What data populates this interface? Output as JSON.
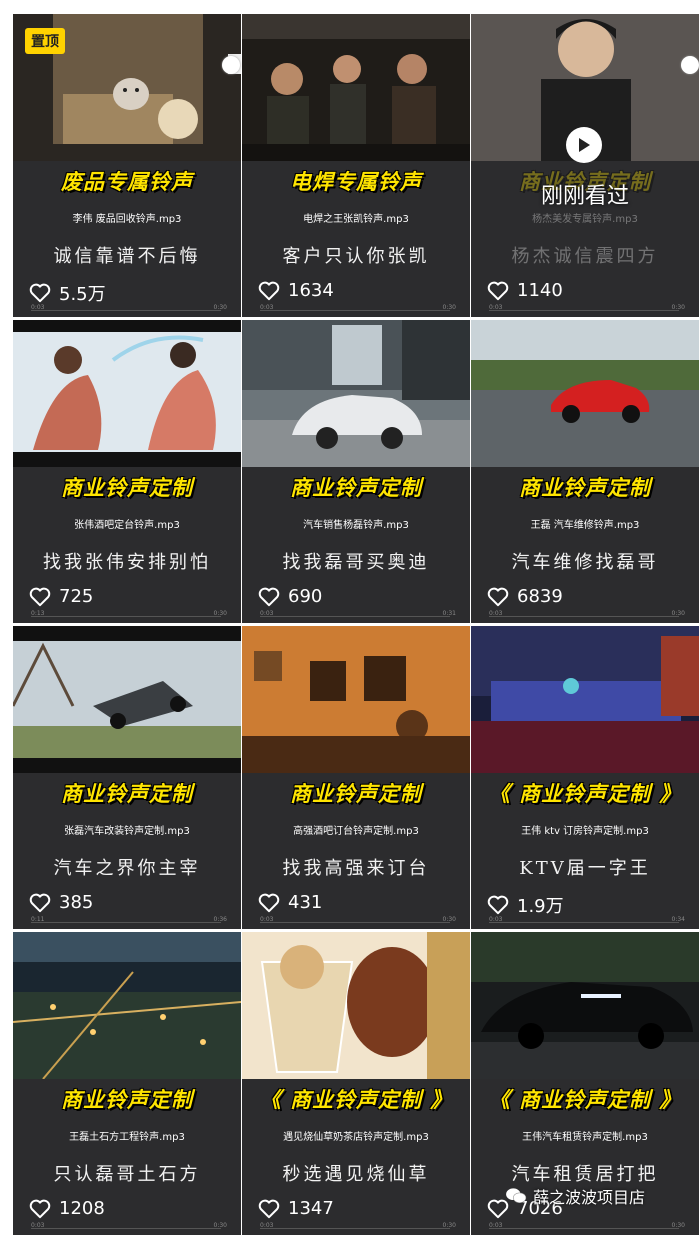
{
  "pinned_badge": "置顶",
  "recently_watched": "刚刚看过",
  "watermark": "薛之波波项目店",
  "cards": [
    {
      "title": "废品专属铃声",
      "filename": "李伟 废品回收铃声.mp3",
      "caption": "诚信靠谱不后悔",
      "likes": "5.5万",
      "time_start": "0:03",
      "time_end": "0:30"
    },
    {
      "title": "电焊专属铃声",
      "filename": "电焊之王张凯铃声.mp3",
      "caption": "客户只认你张凯",
      "likes": "1634",
      "time_start": "0:03",
      "time_end": "0:30"
    },
    {
      "title": "商业铃声定制",
      "filename": "杨杰美发专属铃声.mp3",
      "caption": "杨杰诚信震四方",
      "likes": "1140",
      "time_start": "0:03",
      "time_end": "0:30"
    },
    {
      "title": "商业铃声定制",
      "filename": "张伟酒吧定台铃声.mp3",
      "caption": "找我张伟安排别怕",
      "likes": "725",
      "time_start": "0:13",
      "time_end": "0:30"
    },
    {
      "title": "商业铃声定制",
      "filename": "汽车销售杨磊铃声.mp3",
      "caption": "找我磊哥买奥迪",
      "likes": "690",
      "time_start": "0:03",
      "time_end": "0:31"
    },
    {
      "title": "商业铃声定制",
      "filename": "王磊 汽车维修铃声.mp3",
      "caption": "汽车维修找磊哥",
      "likes": "6839",
      "time_start": "0:03",
      "time_end": "0:30"
    },
    {
      "title": "商业铃声定制",
      "filename": "张磊汽车改装铃声定制.mp3",
      "caption": "汽车之界你主宰",
      "likes": "385",
      "time_start": "0:11",
      "time_end": "0:36"
    },
    {
      "title": "商业铃声定制",
      "filename": "高强酒吧订台铃声定制.mp3",
      "caption": "找我高强来订台",
      "likes": "431",
      "time_start": "0:03",
      "time_end": "0:30"
    },
    {
      "title": "《 商业铃声定制 》",
      "filename": "王伟 ktv 订房铃声定制.mp3",
      "caption": "KTV届一字王",
      "likes": "1.9万",
      "time_start": "0:03",
      "time_end": "0:34"
    },
    {
      "title": "商业铃声定制",
      "filename": "王磊土石方工程铃声.mp3",
      "caption": "只认磊哥土石方",
      "likes": "1208",
      "time_start": "0:03",
      "time_end": "0:30"
    },
    {
      "title": "《 商业铃声定制 》",
      "filename": "遇见烧仙草奶茶店铃声定制.mp3",
      "caption": "秒选遇见烧仙草",
      "likes": "1347",
      "time_start": "0:03",
      "time_end": "0:30"
    },
    {
      "title": "《 商业铃声定制 》",
      "filename": "王伟汽车租赁铃声定制.mp3",
      "caption": "汽车租赁居打把",
      "likes": "7026",
      "time_start": "0:03",
      "time_end": "0:30"
    }
  ]
}
